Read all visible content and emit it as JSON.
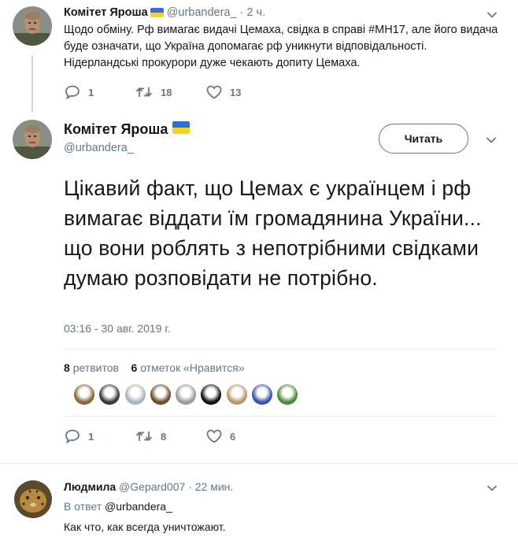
{
  "parent_tweet": {
    "name": "Комітет Яроша",
    "handle": "@urbandera_",
    "time": "· 2 ч.",
    "text": "Щодо обміну. Рф вимагає видачі Цемаха, свідка в справі #МН17, але його видача буде означати, що Україна допомагає рф уникнути відповідальності. Нідерландські прокурори дуже чекають допиту Цемаха.",
    "replies": "1",
    "retweets": "18",
    "likes": "13"
  },
  "main_tweet": {
    "name": "Комітет Яроша",
    "handle": "@urbandera_",
    "follow_label": "Читать",
    "text": "Цікавий факт, що Цемах є українцем і рф вимагає віддати їм громадянина України... що вони роблять з непотрібними свідками думаю розповідати не потрібно.",
    "timestamp": "03:16 - 30 авг. 2019 г.",
    "retweet_count": "8",
    "retweet_label": "ретвитов",
    "like_count": "6",
    "like_label": "отметок «Нравится»",
    "replies": "1",
    "retweets": "8",
    "likes": "6",
    "liker_colors": [
      "#8a6a3c",
      "#3a3a3a",
      "#aab4bd",
      "#6b4e2e",
      "#9c9c9c",
      "#111111",
      "#b79a6b",
      "#3b54a8",
      "#4e8a3a"
    ]
  },
  "reply_tweet": {
    "name": "Людмила",
    "handle": "@Gepard007",
    "time": "· 22 мин.",
    "in_reply_prefix": "В ответ",
    "in_reply_handle": "@urbandera_",
    "text": "Как что, как всегда уничтожают."
  },
  "colors": {
    "text_primary": "#14171a",
    "text_secondary": "#657786",
    "divider": "#e6ecf0",
    "flag_blue": "#2f6fd6",
    "flag_yellow": "#f7d21e"
  },
  "icons": {
    "reply": "reply-icon",
    "retweet": "retweet-icon",
    "like": "heart-icon",
    "more": "chevron-down-icon",
    "flag": "ukraine-flag-icon"
  }
}
